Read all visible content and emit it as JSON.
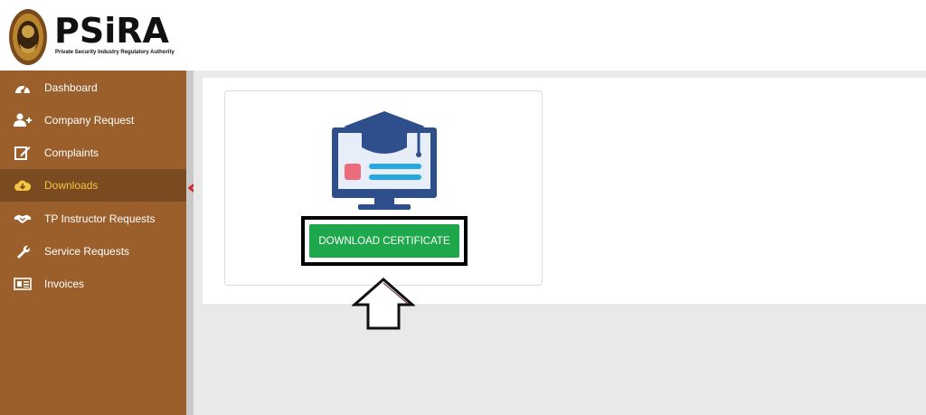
{
  "brand": {
    "name": "PSiRA",
    "tagline": "Private Security Industry Regulatory Authority"
  },
  "sidebar": {
    "items": [
      {
        "label": "Dashboard",
        "icon": "dashboard-icon"
      },
      {
        "label": "Company Request",
        "icon": "user-plus-icon"
      },
      {
        "label": "Complaints",
        "icon": "edit-icon"
      },
      {
        "label": "Downloads",
        "icon": "cloud-download-icon",
        "active": true
      },
      {
        "label": "TP Instructor Requests",
        "icon": "handshake-icon"
      },
      {
        "label": "Service Requests",
        "icon": "wrench-icon"
      },
      {
        "label": "Invoices",
        "icon": "newspaper-icon"
      }
    ]
  },
  "card": {
    "icon": "graduation-monitor-icon",
    "button_label": "DOWNLOAD CERTIFICATE"
  },
  "colors": {
    "sidebar_bg": "#9a5f2b",
    "sidebar_active_bg": "#7a4a20",
    "active_text": "#f4c542",
    "button_green": "#1fa84b",
    "annotation_red": "#d42a2a",
    "annotation_dark": "#5a1a1a"
  }
}
